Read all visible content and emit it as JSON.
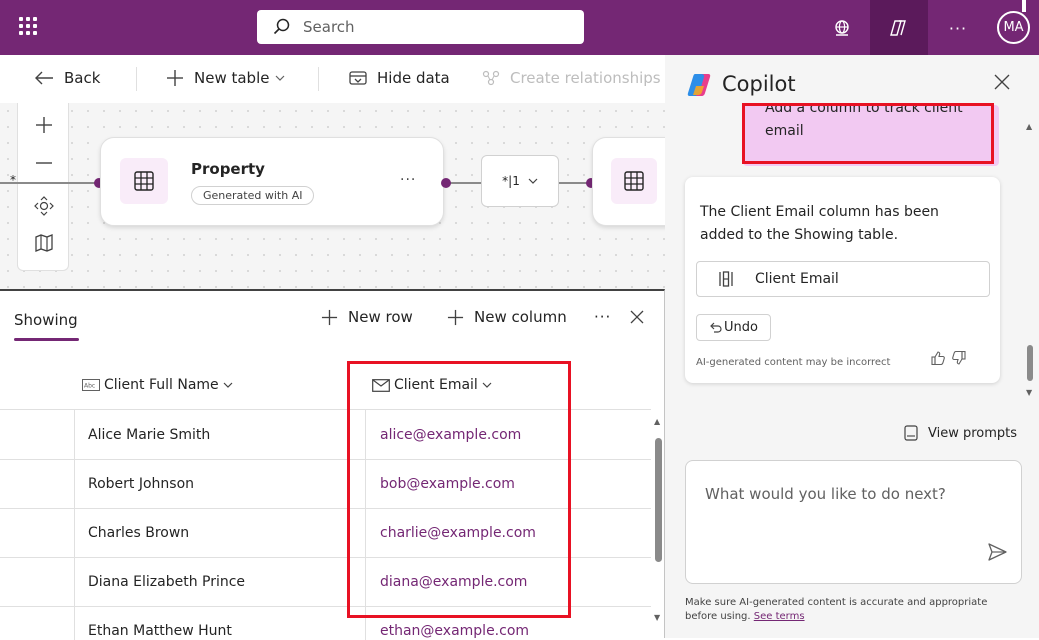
{
  "topbar": {
    "search_placeholder": "Search",
    "avatar_initials": "MA",
    "more_label": "···"
  },
  "command_bar": {
    "back_label": "Back",
    "new_table_label": "New table",
    "hide_data_label": "Hide data",
    "create_relationships_label": "Create relationships"
  },
  "canvas": {
    "node_title": "Property",
    "node_badge": "Generated with AI",
    "node_more": "···",
    "relationship_label": "*|1",
    "left_edge_label": "*"
  },
  "grid": {
    "table_name": "Showing",
    "new_row_label": "New row",
    "new_column_label": "New column",
    "more_label": "···",
    "columns": [
      {
        "label": "Client Full Name"
      },
      {
        "label": "Client Email"
      }
    ],
    "rows": [
      {
        "name": "Alice Marie Smith",
        "email": "alice@example.com"
      },
      {
        "name": "Robert Johnson",
        "email": "bob@example.com"
      },
      {
        "name": "Charles Brown",
        "email": "charlie@example.com"
      },
      {
        "name": "Diana Elizabeth Prince",
        "email": "diana@example.com"
      },
      {
        "name": "Ethan Matthew Hunt",
        "email": "ethan@example.com"
      }
    ]
  },
  "copilot": {
    "title": "Copilot",
    "user_message": "Add a column to track client email",
    "ai_response": "The Client Email column has been added to the Showing table.",
    "chip_label": "Client Email",
    "undo_label": "Undo",
    "ai_note": "AI-generated content may be incorrect",
    "view_prompts_label": "View prompts",
    "input_placeholder": "What would you like to do next?",
    "disclaimer": "Make sure AI-generated content is accurate and appropriate before using.",
    "see_terms_label": "See terms"
  },
  "colors": {
    "brand": "#742774",
    "highlight": "#e81123",
    "user_bubble": "#f2c9f2"
  }
}
